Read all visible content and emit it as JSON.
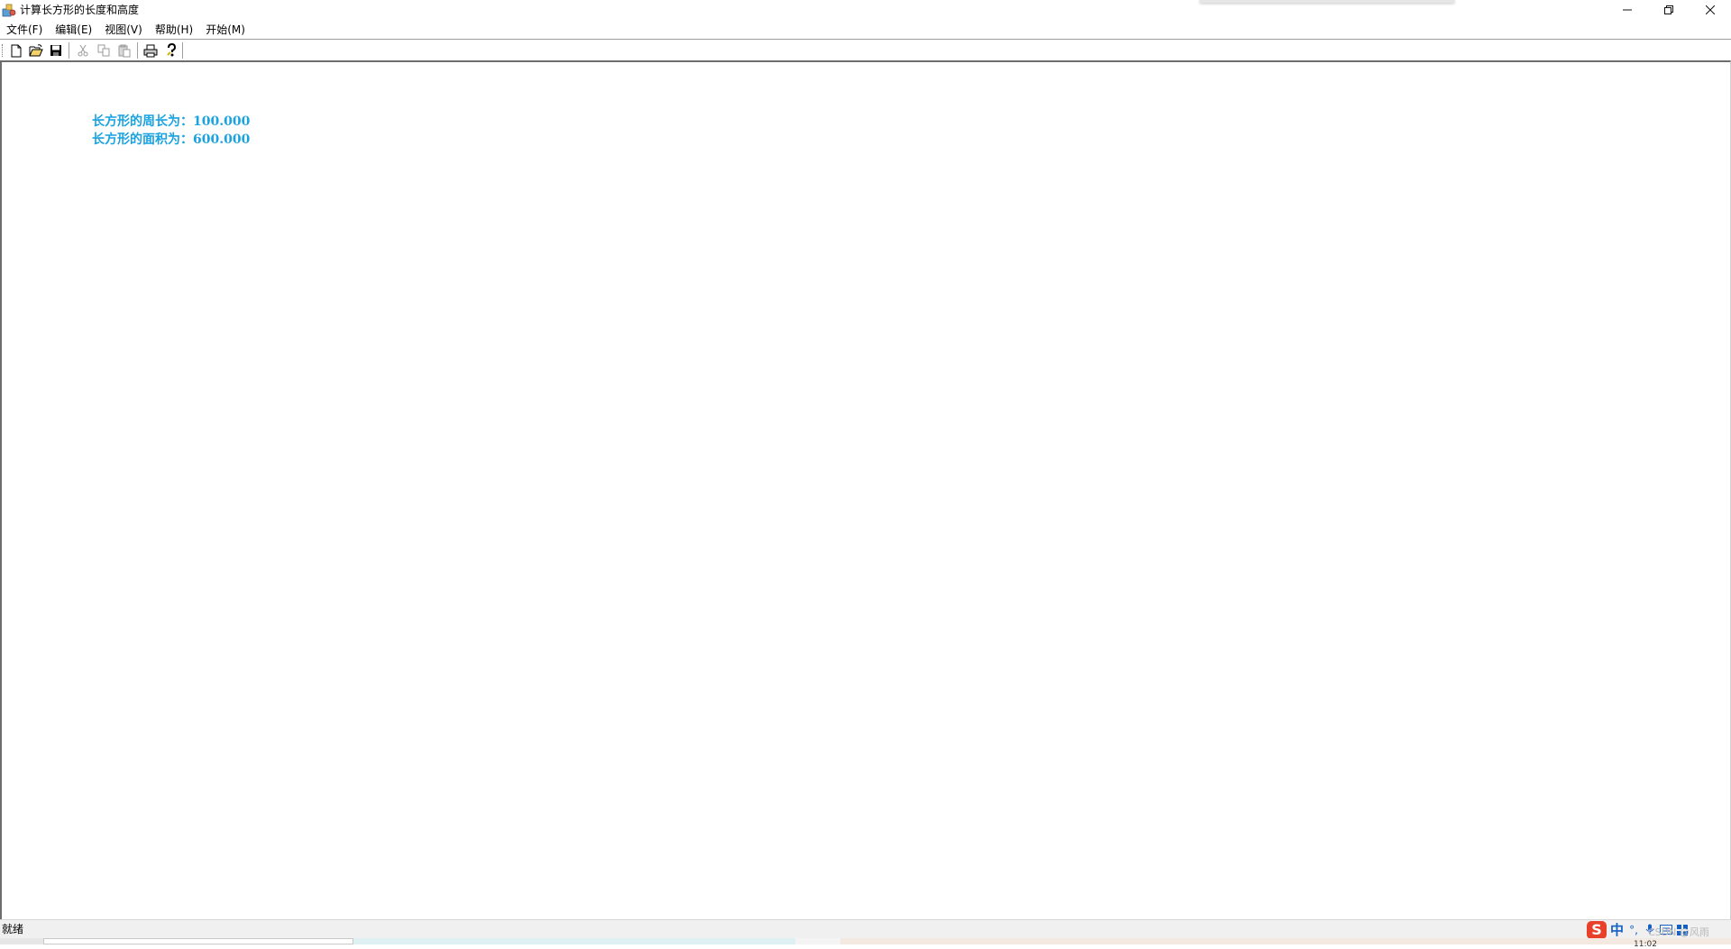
{
  "window": {
    "title": "计算长方形的长度和高度",
    "controls": {
      "minimize": "—",
      "maximize": "❐",
      "close": "✕"
    }
  },
  "menu": [
    {
      "label": "文件(F)"
    },
    {
      "label": "编辑(E)"
    },
    {
      "label": "视图(V)"
    },
    {
      "label": "帮助(H)"
    },
    {
      "label": "开始(M)"
    }
  ],
  "toolbar": {
    "buttons": [
      {
        "icon": "new-file-icon",
        "enabled": true
      },
      {
        "icon": "open-folder-icon",
        "enabled": true
      },
      {
        "icon": "save-icon",
        "enabled": true
      },
      {
        "icon": "cut-icon",
        "enabled": false
      },
      {
        "icon": "copy-icon",
        "enabled": false
      },
      {
        "icon": "paste-icon",
        "enabled": false
      },
      {
        "icon": "print-icon",
        "enabled": true
      },
      {
        "icon": "help-icon",
        "enabled": true
      }
    ]
  },
  "output": {
    "color": "#1aa3e0",
    "lines": [
      "长方形的周长为：100.000",
      "长方形的面积为：600.000"
    ]
  },
  "status": {
    "text": "就绪",
    "ime": {
      "s_badge": "S",
      "mode": "中"
    },
    "watermark": "CSDN @风雨",
    "time_partial": "11:02"
  }
}
